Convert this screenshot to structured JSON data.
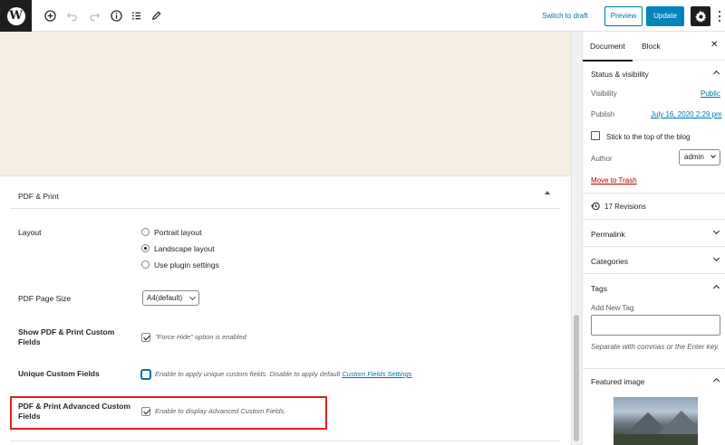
{
  "toolbar": {
    "logo_glyph": "W",
    "switch_to_draft": "Switch to draft",
    "preview": "Preview",
    "update": "Update",
    "icons": [
      "add-block-icon",
      "undo-icon",
      "redo-icon",
      "info-icon",
      "list-view-icon",
      "edit-icon",
      "gear-icon",
      "more-options-icon"
    ]
  },
  "metabox": {
    "title": "PDF & Print",
    "layout": {
      "label": "Layout",
      "options": [
        {
          "label": "Portrait layout",
          "checked": false
        },
        {
          "label": "Landscape layout",
          "checked": true
        },
        {
          "label": "Use plugin settings",
          "checked": false
        }
      ]
    },
    "page_size": {
      "label": "PDF Page Size",
      "value": "A4(default)"
    },
    "show_custom_fields": {
      "label": "Show PDF & Print Custom Fields",
      "checked": true,
      "hint": "\"Force Hide\" option is enabled"
    },
    "unique_custom_fields": {
      "label": "Unique Custom Fields",
      "checked": false,
      "hint": "Enable to apply unique custom fields. Disable to apply default",
      "link": "Custom Fields Settings"
    },
    "advanced_custom_fields": {
      "label": "PDF & Print Advanced Custom Fields",
      "checked": true,
      "hint": "Enable to display Advanced Custom Fields."
    }
  },
  "sidebar": {
    "tabs": {
      "document": "Document",
      "block": "Block"
    },
    "close": "✕",
    "status": {
      "title": "Status & visibility",
      "visibility_label": "Visibility",
      "visibility_value": "Public",
      "publish_label": "Publish",
      "publish_value": "July 16, 2020 2:29 pm",
      "stick_label": "Stick to the top of the blog",
      "author_label": "Author",
      "author_value": "admin",
      "trash": "Move to Trash"
    },
    "revisions": "17 Revisions",
    "permalink": "Permalink",
    "categories": "Categories",
    "tags": {
      "title": "Tags",
      "add_label": "Add New Tag",
      "hint": "Separate with commas or the Enter key."
    },
    "featured_image": "Featured image"
  },
  "colors": {
    "accent": "#0073aa",
    "update_button": "#0085ba",
    "highlight_border": "#e02020",
    "canvas_bg": "#f4efe2"
  }
}
